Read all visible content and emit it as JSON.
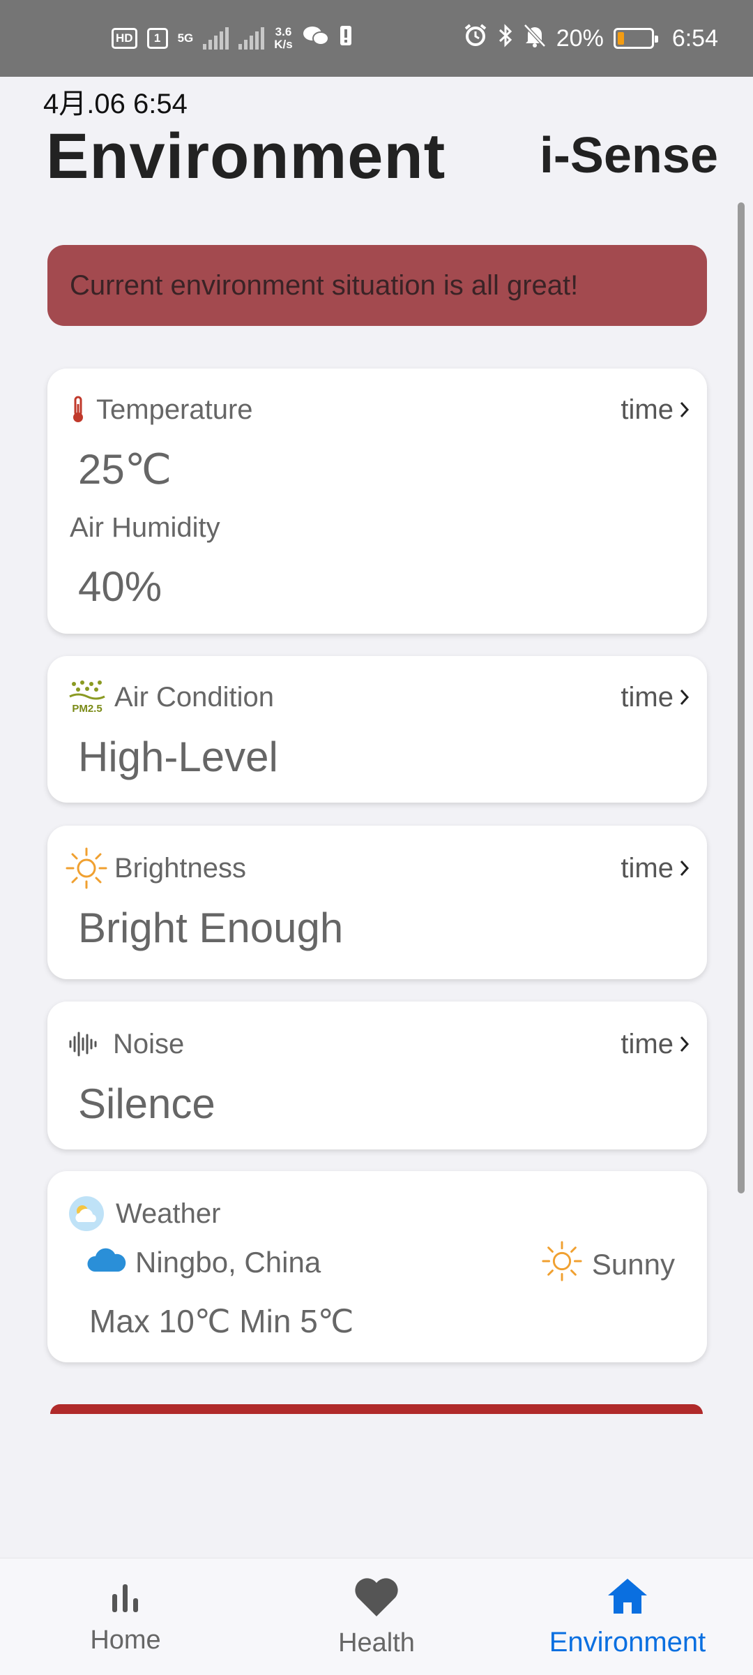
{
  "status_bar": {
    "hd": "HD",
    "sim": "1",
    "network": "5G",
    "speed_value": "3.6",
    "speed_unit": "K/s",
    "battery_percent": "20%",
    "time": "6:54"
  },
  "header": {
    "date": "4月.06 6:54",
    "title": "Environment",
    "brand": "i-Sense"
  },
  "alert": {
    "text": "Current environment situation is all great!",
    "color": "#a34a4f"
  },
  "cards": {
    "temperature": {
      "label": "Temperature",
      "time_link": "time",
      "value": "25℃",
      "humidity_label": "Air Humidity",
      "humidity_value": "40%",
      "icon": "thermometer-icon"
    },
    "air": {
      "label": "Air Condition",
      "time_link": "time",
      "value": "High-Level",
      "icon": "pm25-icon",
      "icon_text": "PM2.5"
    },
    "brightness": {
      "label": "Brightness",
      "time_link": "time",
      "value": "Bright Enough",
      "icon": "sun-icon"
    },
    "noise": {
      "label": "Noise",
      "time_link": "time",
      "value": "Silence",
      "icon": "sound-wave-icon"
    },
    "weather": {
      "label": "Weather",
      "location": "Ningbo, China",
      "condition": "Sunny",
      "range": "Max 10℃ Min 5℃",
      "icon": "weather-icon"
    }
  },
  "nav": {
    "items": [
      {
        "label": "Home",
        "icon": "bar-chart-icon",
        "active": false
      },
      {
        "label": "Health",
        "icon": "heart-icon",
        "active": false
      },
      {
        "label": "Environment",
        "icon": "house-icon",
        "active": true
      }
    ],
    "active_color": "#0a6fe0"
  }
}
